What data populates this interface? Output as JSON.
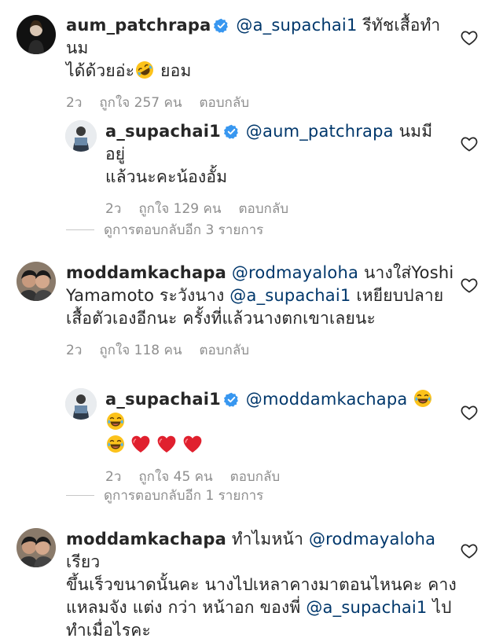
{
  "comments": [
    {
      "user": "aum_patchrapa",
      "mention": "@a_supachai1",
      "text_1": "รีทัชเสื้อทำนม",
      "text_2": "ได้ด้วยอ่ะ",
      "text_3": "ยอม",
      "time": "2ว",
      "likes": "ถูกใจ 257 คน",
      "reply": "ตอบกลับ"
    },
    {
      "user": "a_supachai1",
      "mention": "@aum_patchrapa",
      "text_1": "นมมีอยู่",
      "text_2": "แล้วนะคะน้องอั้ม",
      "time": "2ว",
      "likes": "ถูกใจ 129 คน",
      "reply": "ตอบกลับ"
    },
    {
      "user": "moddamkachapa",
      "mention": "@rodmayaloha",
      "text_1": "นางใส่Yoshi",
      "text_2": "Yamamoto ระวังนาง",
      "mention_2": "@a_supachai1",
      "text_3": "เหยียบปลาย",
      "text_4": "เสื้อตัวเองอีกนะ ครั้งที่แล้วนางตกเขาเลยนะ",
      "time": "2ว",
      "likes": "ถูกใจ 118 คน",
      "reply": "ตอบกลับ"
    },
    {
      "user": "a_supachai1",
      "mention": "@moddamkachapa",
      "time": "2ว",
      "likes": "ถูกใจ 45 คน",
      "reply": "ตอบกลับ"
    },
    {
      "user": "moddamkachapa",
      "text_1": "ทำไมหน้า",
      "mention": "@rodmayaloha",
      "text_2": "เรียว",
      "text_3": "ขึ้นเร็วขนาดนั้นคะ นางไปเหลาคางมาตอนไหนคะ คาง",
      "text_4": "แหลมจัง แต่ง กว่า หน้าอก ของพี่",
      "mention_2": "@a_supachai1",
      "text_5": "ไป",
      "text_6": "ทำเมื่อไรคะ"
    }
  ],
  "view_more": [
    {
      "label": "ดูการตอบกลับอีก 3 รายการ"
    },
    {
      "label": "ดูการตอบกลับอีก 1 รายการ"
    }
  ],
  "icons": {
    "verified": "verified-badge-icon",
    "like": "heart-outline-icon",
    "laugh": "face-with-tears-of-joy-emoji",
    "rofl": "rolling-on-the-floor-laughing-emoji",
    "heart": "red-heart-emoji"
  },
  "colors": {
    "text": "#262626",
    "secondary": "#8e8e8e",
    "mention": "#00376b",
    "verified": "#3897f0",
    "heart_emoji": "#e0202e"
  }
}
